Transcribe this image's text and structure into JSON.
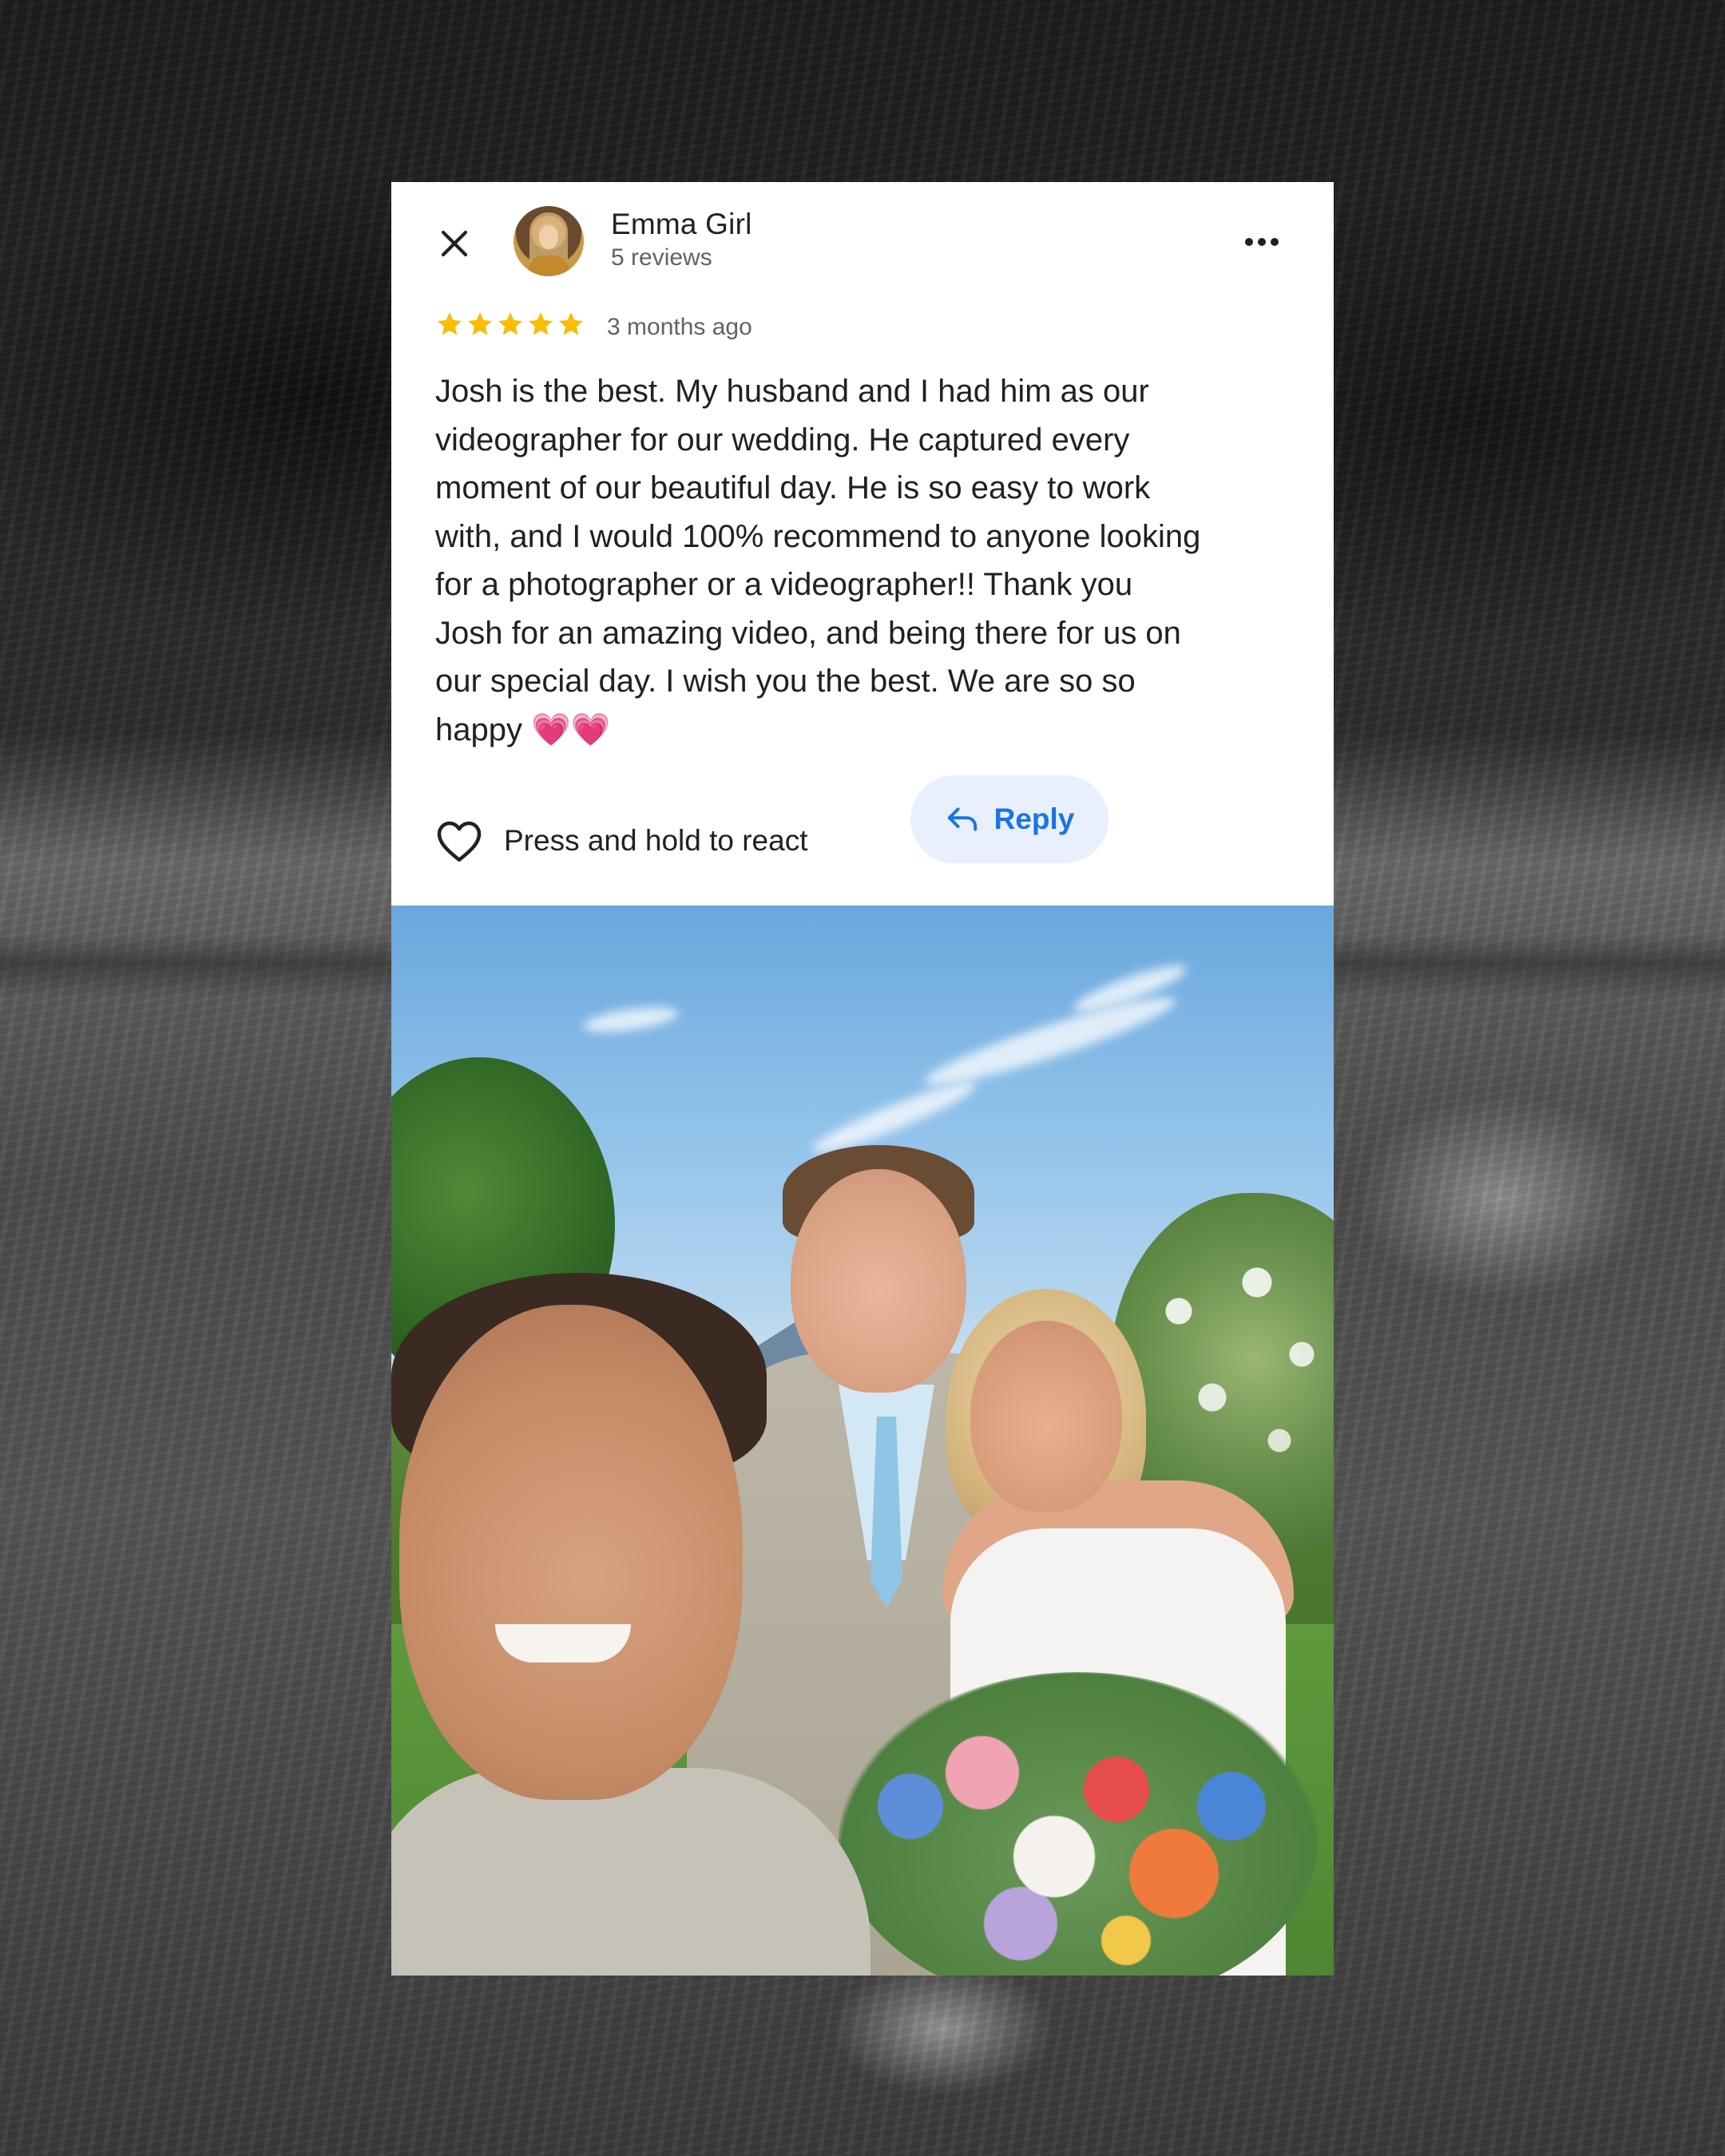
{
  "review": {
    "close_icon": "close-icon",
    "reviewer_name": "Emma Girl",
    "reviewer_count": "5 reviews",
    "more_icon": "more-horizontal-icon",
    "rating": 5,
    "date": "3 months ago",
    "text": "Josh is the best. My husband and I had him as our\nvideographer for our wedding. He captured every\nmoment of our beautiful day. He is so easy to work\nwith, and I would 100% recommend to anyone looking\nfor a photographer or a videographer!! Thank you\nJosh for an amazing video, and being there for us on\nour special day. I wish you the best. We are so so\nhappy 💗💗",
    "react_label": "Press and hold to react",
    "react_icon": "heart-outline-icon",
    "reply_label": "Reply",
    "reply_icon": "reply-arrow-icon"
  },
  "colors": {
    "star": "#fbbc04",
    "reply_text": "#1a73e8",
    "reply_bg": "#e8f0fe",
    "text_primary": "#202124",
    "text_secondary": "#5f6368"
  }
}
